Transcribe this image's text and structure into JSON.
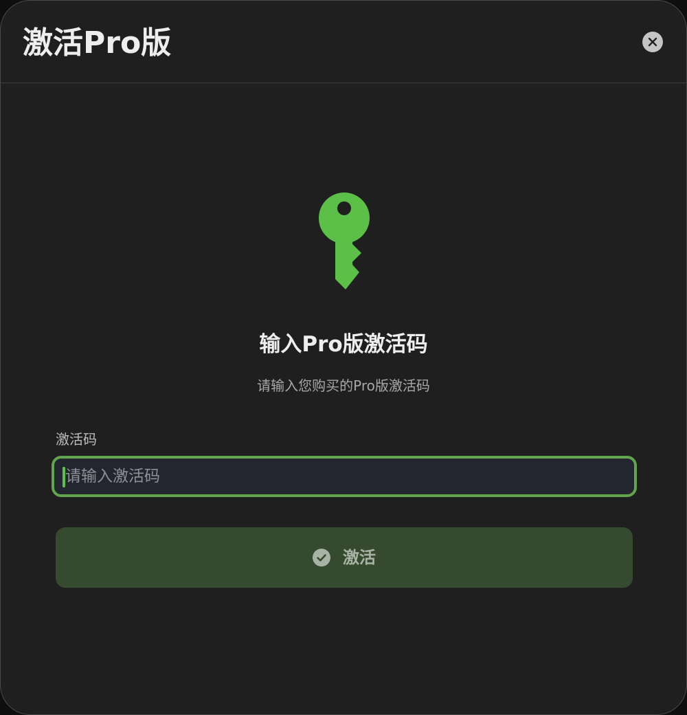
{
  "dialog": {
    "title": "激活Pro版",
    "close_icon": "close-icon"
  },
  "hero": {
    "icon": "key-icon",
    "icon_color": "#5cbf48",
    "heading": "输入Pro版激活码",
    "subtitle": "请输入您购买的Pro版激活码"
  },
  "form": {
    "field_label": "激活码",
    "input_value": "",
    "input_placeholder": "请输入激活码",
    "focus_color": "#62a54c"
  },
  "actions": {
    "activate_label": "激活",
    "activate_icon": "check-circle-icon",
    "button_color": "#354a2e"
  }
}
